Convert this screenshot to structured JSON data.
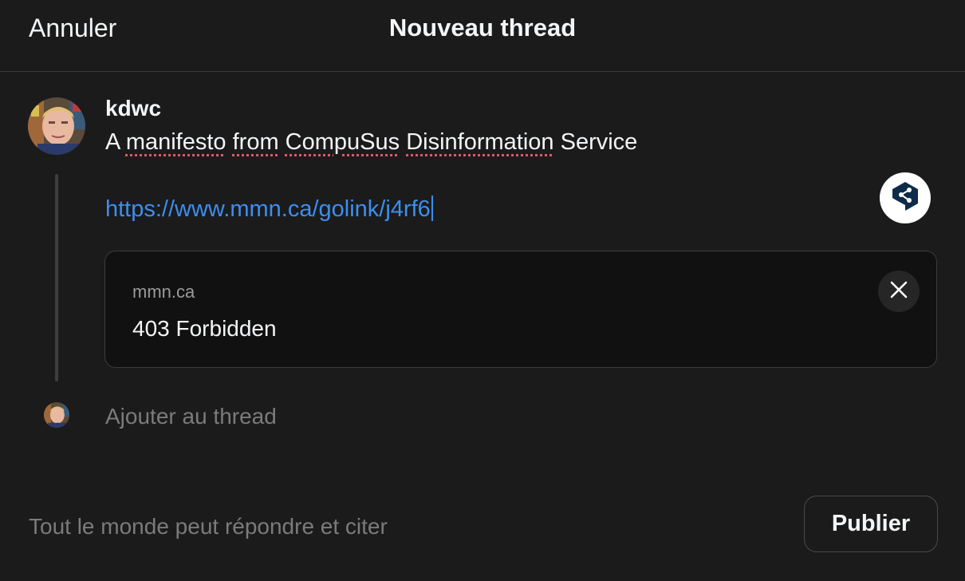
{
  "header": {
    "cancel_label": "Annuler",
    "title": "Nouveau thread"
  },
  "post": {
    "username": "kdwc",
    "text_words": [
      "A",
      "manifesto",
      "from",
      "CompuSus",
      "Disinformation",
      "Service"
    ],
    "link": "https://www.mmn.ca/golink/j4rf6"
  },
  "link_preview": {
    "domain": "mmn.ca",
    "title": "403 Forbidden"
  },
  "add_to_thread_placeholder": "Ajouter au thread",
  "footer": {
    "reply_setting": "Tout le monde peut répondre et citer",
    "publish_label": "Publier"
  },
  "icons": {
    "share": "share-icon",
    "close": "close-icon"
  },
  "colors": {
    "background": "#1b1b1b",
    "link": "#3c8ef0",
    "spellcheck": "#e0566a",
    "muted": "#7b7b7b"
  }
}
